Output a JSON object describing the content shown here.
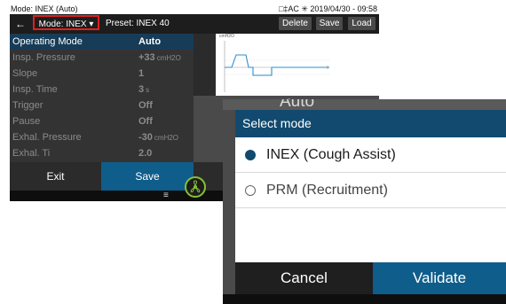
{
  "status_bar": {
    "mode_text": "Mode: INEX (Auto)",
    "right_text": "□‡AC ✳ 2019/04/30 - 09:58"
  },
  "top_bar": {
    "back_icon": "back-arrow-icon",
    "mode_dropdown_label": "Mode: INEX",
    "dropdown_caret": "▾",
    "preset_label": "Preset: INEX 40",
    "delete_label": "Delete",
    "save_label": "Save",
    "load_label": "Load"
  },
  "parameters": [
    {
      "label": "Operating Mode",
      "value": "Auto",
      "unit": ""
    },
    {
      "label": "Insp. Pressure",
      "value": "+33",
      "unit": "cmH2O"
    },
    {
      "label": "Slope",
      "value": "1",
      "unit": ""
    },
    {
      "label": "Insp. Time",
      "value": "3",
      "unit": "s"
    },
    {
      "label": "Trigger",
      "value": "Off",
      "unit": ""
    },
    {
      "label": "Pause",
      "value": "Off",
      "unit": ""
    },
    {
      "label": "Exhal. Pressure",
      "value": "-30",
      "unit": "cmH2O"
    },
    {
      "label": "Exhal. Ti",
      "value": "2.0",
      "unit": ""
    }
  ],
  "graph": {
    "y_label": "cmH2O"
  },
  "background_auto_text": "Auto",
  "bottom_buttons": {
    "exit_label": "Exit",
    "save_label": "Save"
  },
  "bottom_icons": {
    "menu_icon": "≡",
    "fan_icon": "fan-icon"
  },
  "dialog": {
    "title": "Select mode",
    "options": [
      {
        "label": "INEX (Cough Assist)",
        "selected": true
      },
      {
        "label": "PRM (Recruitment)",
        "selected": false
      }
    ],
    "cancel_label": "Cancel",
    "validate_label": "Validate"
  },
  "colors": {
    "accent": "#0f5d8a",
    "dialog_header": "#114a6e",
    "highlight_border": "#e02020",
    "fan_ring": "#86c232"
  }
}
